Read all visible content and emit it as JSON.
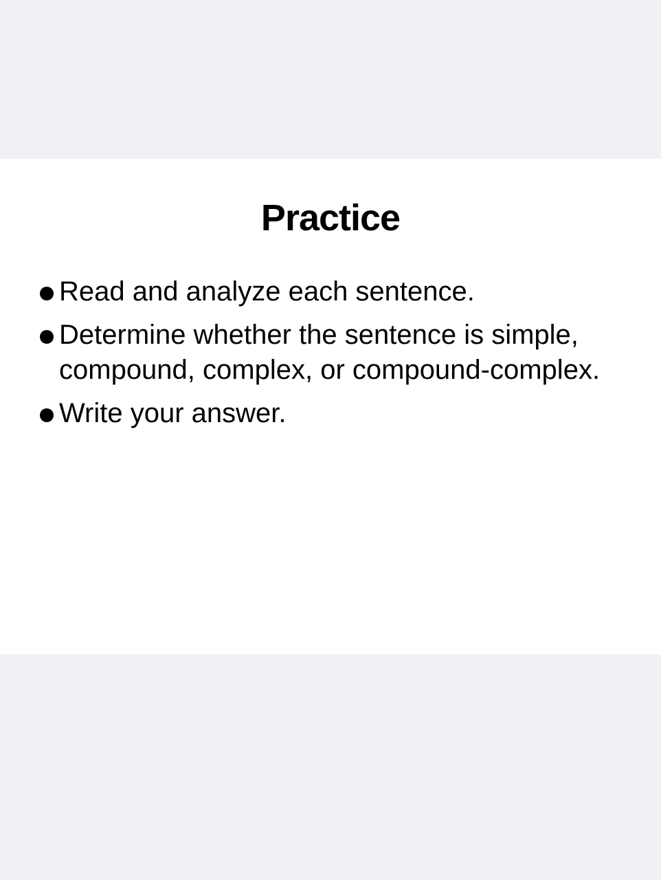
{
  "slide": {
    "title": "Practice",
    "bullets": [
      "Read and analyze each sentence.",
      "Determine whether the sentence is simple, compound, complex, or compound-complex.",
      "Write your answer."
    ]
  },
  "colors": {
    "page_background": "#eff1f6",
    "slide_background": "#ffffff",
    "text": "#000000"
  }
}
